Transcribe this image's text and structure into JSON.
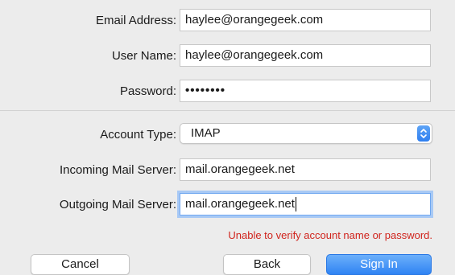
{
  "form": {
    "email": {
      "label": "Email Address:",
      "value": "haylee@orangegeek.com"
    },
    "username": {
      "label": "User Name:",
      "value": "haylee@orangegeek.com"
    },
    "password": {
      "label": "Password:",
      "masked_value": "••••••••"
    },
    "account_type": {
      "label": "Account Type:",
      "selected": "IMAP"
    },
    "incoming_server": {
      "label": "Incoming Mail Server:",
      "value": "mail.orangegeek.net"
    },
    "outgoing_server": {
      "label": "Outgoing Mail Server:",
      "value": "mail.orangegeek.net"
    }
  },
  "error_message": "Unable to verify account name or password.",
  "buttons": {
    "cancel": "Cancel",
    "back": "Back",
    "sign_in": "Sign In"
  },
  "colors": {
    "accent": "#2f83f3",
    "error": "#d0241d",
    "background": "#ececec"
  },
  "icons": {
    "select_arrows": "up-down-chevron-icon"
  }
}
